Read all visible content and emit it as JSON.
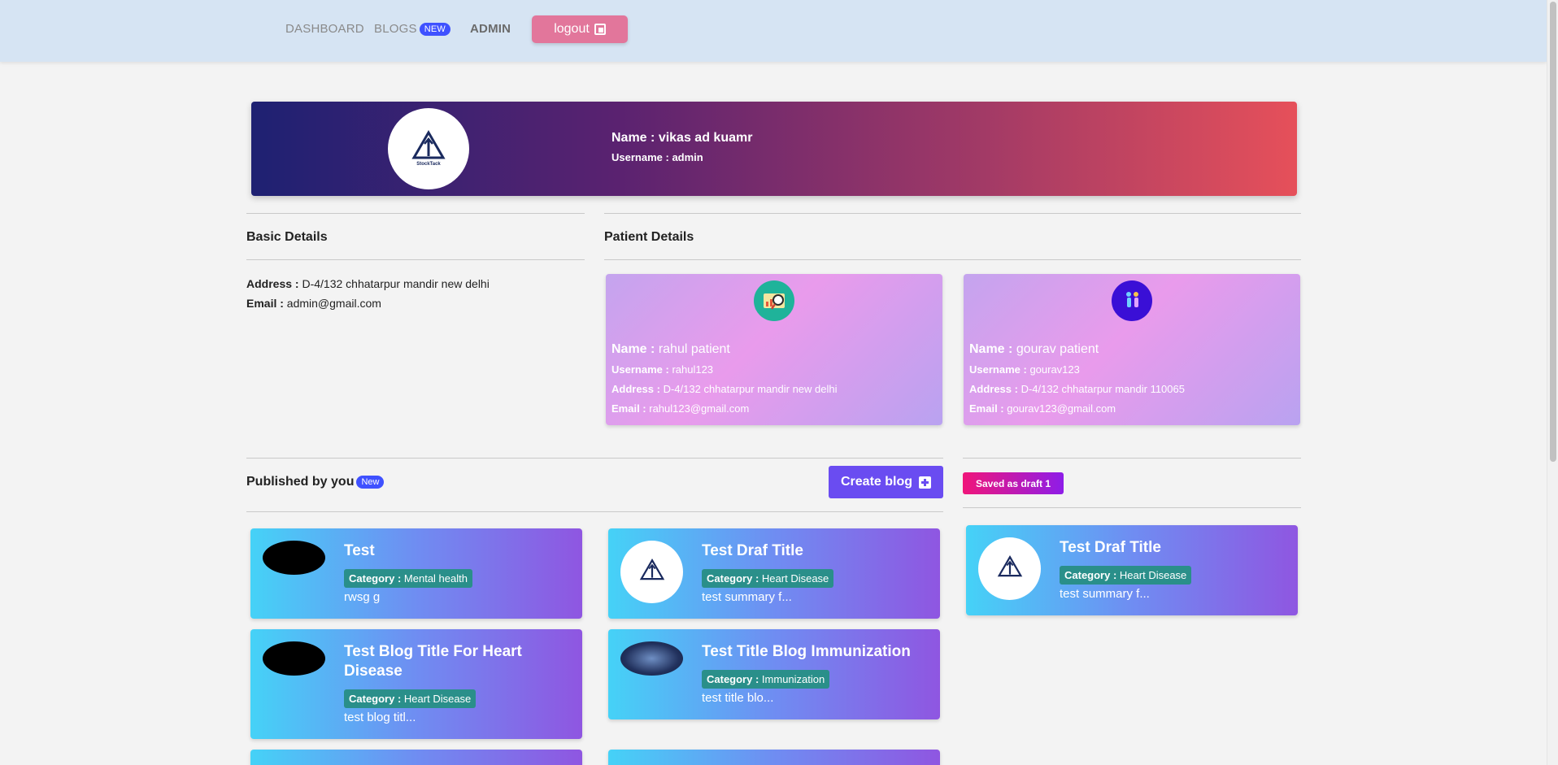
{
  "nav": {
    "dashboard": "DASHBOARD",
    "blogs": "BLOGS",
    "blogs_badge": "NEW",
    "admin": "ADMIN",
    "logout": "logout"
  },
  "profile": {
    "logo_text": "StockTack",
    "name_label": "Name :",
    "name": "vikas ad kuamr",
    "username_label": "Username :",
    "username": "admin"
  },
  "basic_details": {
    "title": "Basic Details",
    "address_label": "Address :",
    "address": "D-4/132 chhatarpur mandir new delhi",
    "email_label": "Email :",
    "email": "admin@gmail.com"
  },
  "patient_details": {
    "title": "Patient Details",
    "patients": [
      {
        "name_label": "Name :",
        "name": "rahul patient",
        "username_label": "Username :",
        "username": "rahul123",
        "address_label": "Address :",
        "address": "D-4/132 chhatarpur mandir new delhi",
        "email_label": "Email :",
        "email": "rahul123@gmail.com",
        "avatar_icon": "magnifier-chart-icon",
        "avatar_color": "#1fb39a"
      },
      {
        "name_label": "Name :",
        "name": "gourav patient",
        "username_label": "Username :",
        "username": "gourav123",
        "address_label": "Address :",
        "address": "D-4/132 chhatarpur mandir 110065",
        "email_label": "Email :",
        "email": "gourav123@gmail.com",
        "avatar_icon": "people-icon",
        "avatar_color": "#3a0fd6"
      }
    ]
  },
  "published": {
    "title": "Published by you",
    "badge": "New",
    "create_label": "Create blog",
    "draft_label": "Saved as draft 1",
    "category_label": "Category :",
    "blogs": [
      {
        "title": "Test",
        "category": "Mental health",
        "summary": "rwsg g",
        "thumb": "dark"
      },
      {
        "title": "Test Draf Title",
        "category": "Heart Disease",
        "summary": "test summary f...",
        "thumb": "logo"
      },
      {
        "title": "Test Blog Title For Heart Disease",
        "category": "Heart Disease",
        "summary": "test blog titl...",
        "thumb": "dark"
      },
      {
        "title": "Test Title Blog Immunization",
        "category": "Immunization",
        "summary": "test title blo...",
        "thumb": "blue"
      }
    ],
    "drafts": [
      {
        "title": "Test Draf Title",
        "category": "Heart Disease",
        "summary": "test summary f...",
        "thumb": "logo"
      }
    ]
  },
  "colors": {
    "navbar_bg": "#d6e4f3",
    "logout_bg": "#e2769b",
    "accent_badge": "#3f51ff",
    "create_btn": "#6a4cf1",
    "category_badge": "#2a8f8a"
  }
}
